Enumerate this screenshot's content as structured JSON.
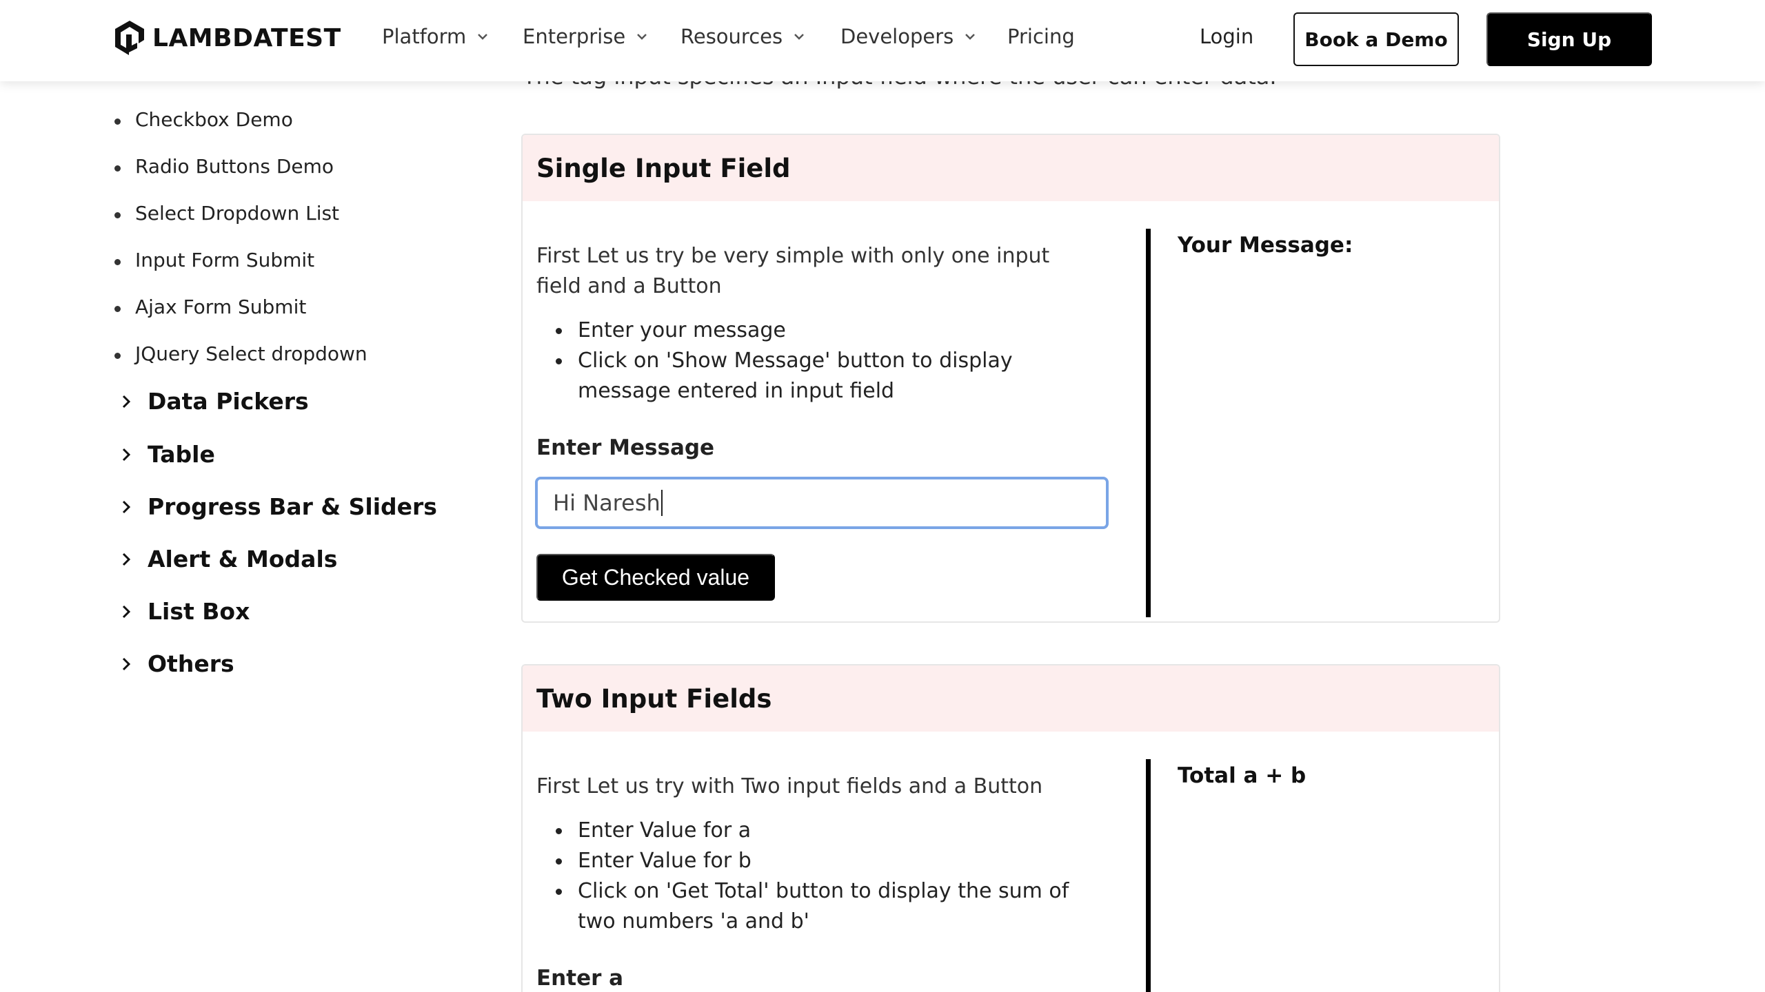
{
  "header": {
    "logo_text": "LAMBDATEST",
    "nav": [
      {
        "label": "Platform"
      },
      {
        "label": "Enterprise"
      },
      {
        "label": "Resources"
      },
      {
        "label": "Developers"
      },
      {
        "label": "Pricing"
      }
    ],
    "login": "Login",
    "book_demo": "Book a Demo",
    "sign_up": "Sign Up"
  },
  "clipped_text": "The tag input specifies an Input field where the user can enter data.",
  "sidebar": {
    "sub_items": [
      {
        "label": "Checkbox Demo"
      },
      {
        "label": "Radio Buttons Demo"
      },
      {
        "label": "Select Dropdown List"
      },
      {
        "label": "Input Form Submit"
      },
      {
        "label": "Ajax Form Submit"
      },
      {
        "label": "JQuery Select dropdown"
      }
    ],
    "sections": [
      {
        "label": "Data Pickers"
      },
      {
        "label": "Table"
      },
      {
        "label": "Progress Bar & Sliders"
      },
      {
        "label": "Alert & Modals"
      },
      {
        "label": "List Box"
      },
      {
        "label": "Others"
      }
    ]
  },
  "single": {
    "title": "Single Input Field",
    "intro": "First Let us try be very simple with only one input field and a Button",
    "bullets": [
      "Enter your message",
      "Click on 'Show Message' button to display message entered in input field"
    ],
    "input_label": "Enter Message",
    "input_value": "Hi Naresh",
    "button": "Get Checked value",
    "result_label": "Your Message:"
  },
  "two": {
    "title": "Two Input Fields",
    "intro": "First Let us try with Two input fields and a Button",
    "bullets": [
      "Enter Value for a",
      "Enter Value for b",
      "Click on 'Get Total' button to display the sum of two numbers 'a and b'"
    ],
    "input_a_label": "Enter a",
    "result_label": "Total a + b"
  }
}
